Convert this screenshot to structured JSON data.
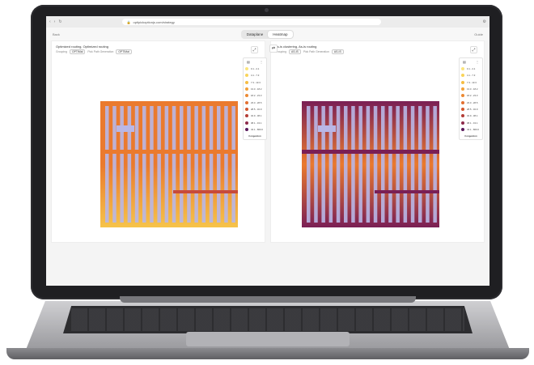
{
  "browser": {
    "url": "optipickoptionjs.com/strategy",
    "back": "‹",
    "fwd": "›",
    "reload": "↻"
  },
  "header": {
    "left": "Back",
    "right": "Guide",
    "tabs": [
      {
        "label": "Dataplane"
      },
      {
        "label": "Heatmap"
      }
    ]
  },
  "left_panel": {
    "title": "Optimized routing, Optimized routing",
    "filter1_label": "Grouping",
    "filter1_value": "OPTIMal",
    "filter2_label": "Pick Path Generation",
    "filter2_value": "OPTIMal"
  },
  "right_panel": {
    "title": "As-is clustering, As-is routing",
    "filter1_label": "Grouping",
    "filter1_value": "AS-IS",
    "filter2_label": "Pick Path Generation",
    "filter2_value": "AS-IS"
  },
  "legend": {
    "footer": "Congestion",
    "items": [
      {
        "label": "0.1 - 4.1",
        "color": "#fbe57c"
      },
      {
        "label": "4.1 - 7.3",
        "color": "#f9d45a"
      },
      {
        "label": "7.3 - 13.3",
        "color": "#f6bd42"
      },
      {
        "label": "13.3 - 18.2",
        "color": "#f2a23a"
      },
      {
        "label": "18.2 - 23.3",
        "color": "#ec8a34"
      },
      {
        "label": "23.3 - 28.5",
        "color": "#e37030"
      },
      {
        "label": "28.5 - 32.9",
        "color": "#d4582e"
      },
      {
        "label": "32.9 - 38.1",
        "color": "#b43d37"
      },
      {
        "label": "38.1 - 43.1",
        "color": "#8d2a4a"
      },
      {
        "label": "43.1 - 800.0",
        "color": "#5a1a5c"
      }
    ]
  },
  "colors": {
    "aisle": "#b9b7e6",
    "hot": "#7a1f55",
    "warm": "#ea7a2e",
    "cool": "#f6c34a"
  }
}
